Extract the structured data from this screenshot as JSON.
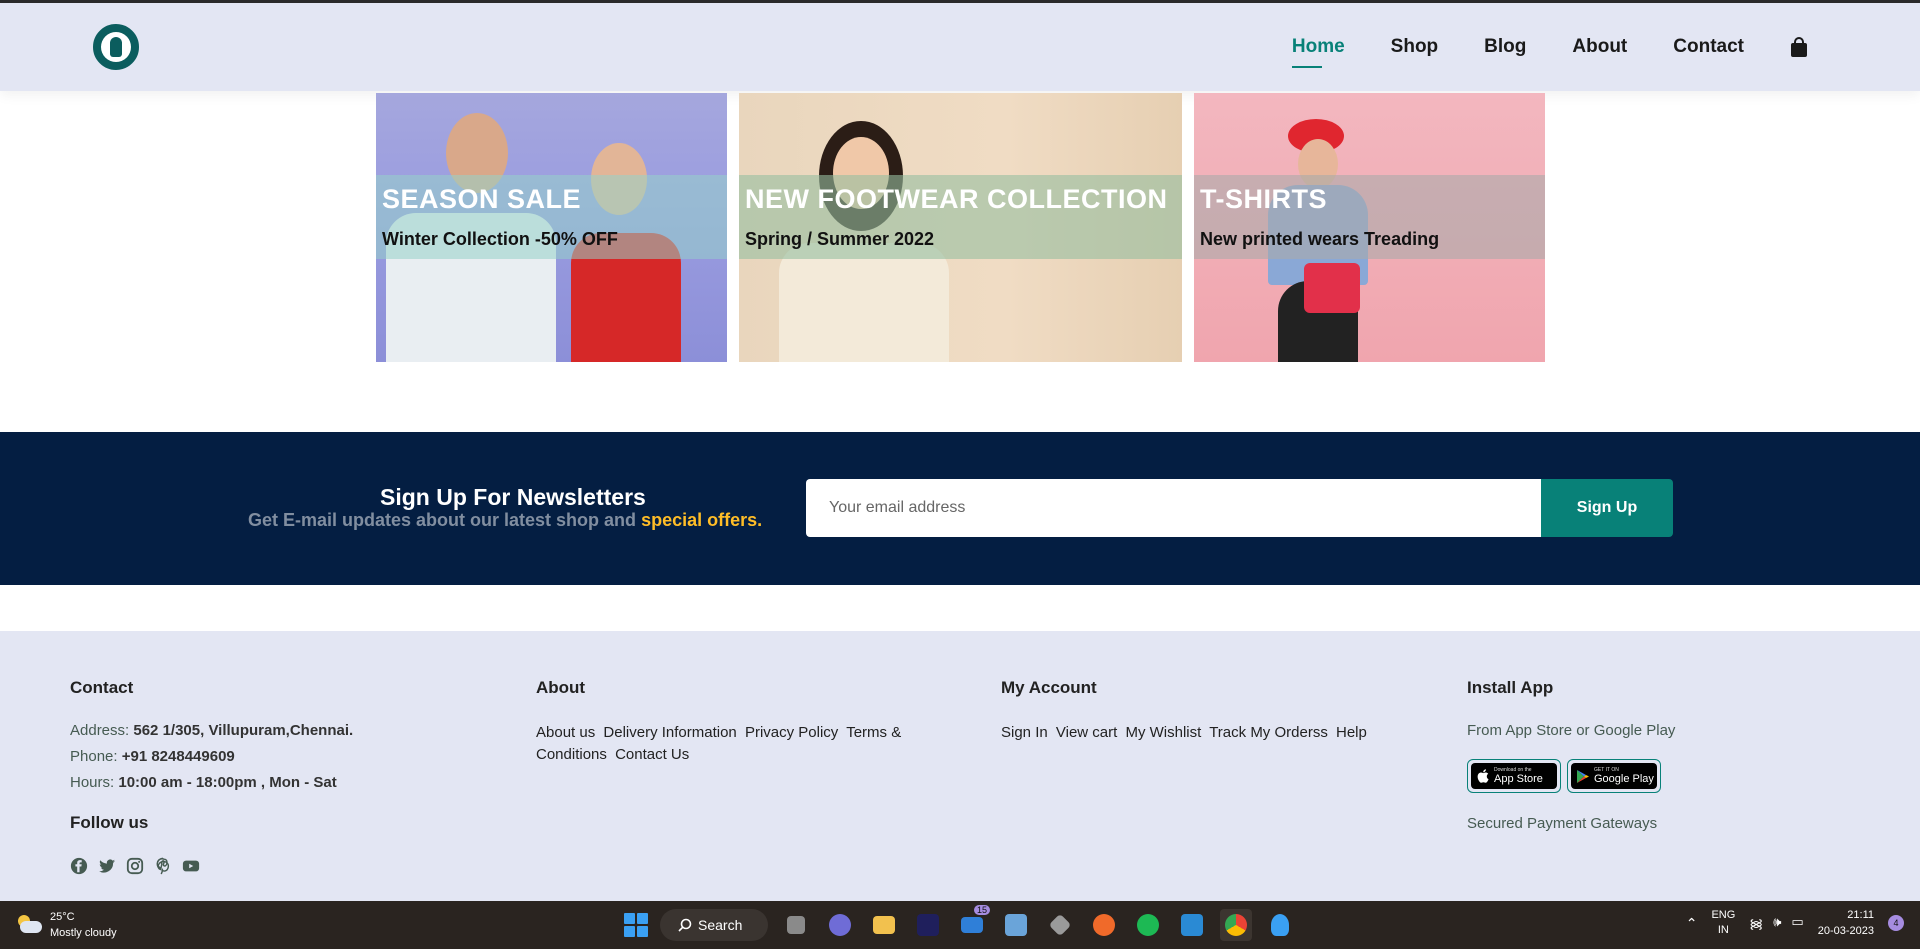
{
  "header": {
    "nav": [
      "Home",
      "Shop",
      "Blog",
      "About",
      "Contact"
    ]
  },
  "banners": [
    {
      "title": "SEASON SALE",
      "subtitle": "Winter Collection -50% OFF"
    },
    {
      "title": "NEW FOOTWEAR COLLECTION",
      "subtitle": "Spring / Summer 2022"
    },
    {
      "title": "T-SHIRTS",
      "subtitle": "New printed wears Treading"
    }
  ],
  "newsletter": {
    "title": "Sign Up For Newsletters",
    "subtitle_start": "Get E-mail updates about our latest shop and",
    "subtitle_highlight": "special offers.",
    "placeholder": "Your email address",
    "button": "Sign Up"
  },
  "footer": {
    "contact": {
      "heading": "Contact",
      "address_label": "Address:",
      "address": "562 1/305, Villupuram,Chennai.",
      "phone_label": "Phone:",
      "phone": "+91 8248449609",
      "hours_label": "Hours:",
      "hours": "10:00 am - 18:00pm , Mon - Sat",
      "follow": "Follow us"
    },
    "about": {
      "heading": "About",
      "links": [
        "About us",
        "Delivery Information",
        "Privacy Policy",
        "Terms & Conditions",
        "Contact Us"
      ]
    },
    "account": {
      "heading": "My Account",
      "links": [
        "Sign In",
        "View cart",
        "My Wishlist",
        "Track My Orderss",
        "Help"
      ]
    },
    "app": {
      "heading": "Install App",
      "subtitle": "From App Store or Google Play",
      "appstore_small": "Download on the",
      "appstore": "App Store",
      "googleplay_small": "GET IT ON",
      "googleplay": "Google Play",
      "payment": "Secured Payment Gateways"
    }
  },
  "taskbar": {
    "temperature": "25°C",
    "weather": "Mostly cloudy",
    "search": "Search",
    "mail_badge": "15",
    "lang1": "ENG",
    "lang2": "IN",
    "time": "21:11",
    "date": "20-03-2023",
    "notifications": "4"
  }
}
